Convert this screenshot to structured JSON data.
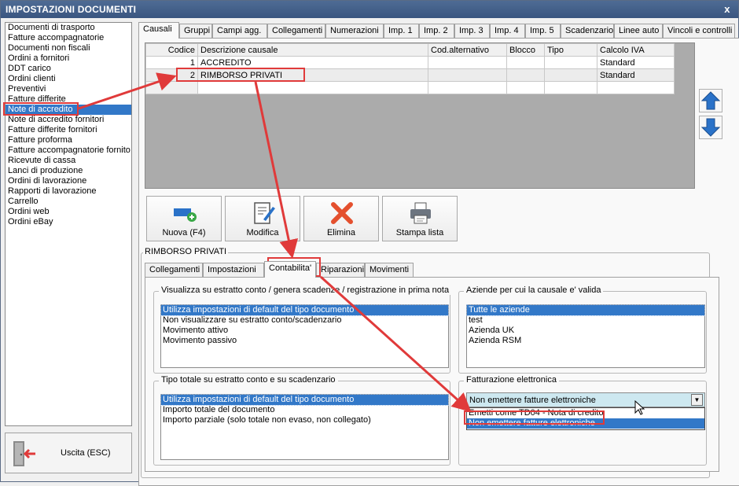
{
  "window": {
    "title": "IMPOSTAZIONI DOCUMENTI",
    "close_label": "x"
  },
  "doc_list": {
    "items": [
      "Documenti di trasporto",
      "Fatture accompagnatorie",
      "Documenti non fiscali",
      "Ordini a fornitori",
      "DDT carico",
      "Ordini clienti",
      "Preventivi",
      "Fatture differite",
      "Note di accredito",
      "Note di accredito fornitori",
      "Fatture differite fornitori",
      "Fatture proforma",
      "Fatture accompagnatorie fornito",
      "Ricevute di cassa",
      "Lanci di produzione",
      "Ordini di lavorazione",
      "Rapporti di lavorazione",
      "Carrello",
      "Ordini web",
      "Ordini eBay"
    ],
    "selected": "Note di accredito"
  },
  "exit_button": {
    "label": "Uscita (ESC)",
    "icon": "exit-door-icon"
  },
  "main_tabs": [
    "Causali",
    "Gruppi",
    "Campi agg.",
    "Collegamenti",
    "Numerazioni",
    "Imp. 1",
    "Imp. 2",
    "Imp. 3",
    "Imp. 4",
    "Imp. 5",
    "Scadenzario",
    "Linee auto",
    "Vincoli e controlli"
  ],
  "causali_table": {
    "columns": [
      "Codice",
      "Descrizione causale",
      "Cod.alternativo",
      "Blocco",
      "Tipo",
      "Calcolo IVA"
    ],
    "rows": [
      {
        "code": "1",
        "description": "ACCREDITO",
        "alt": "",
        "block": "",
        "type": "",
        "vat": "Standard"
      },
      {
        "code": "2",
        "description": "RIMBORSO PRIVATI",
        "alt": "",
        "block": "",
        "type": "",
        "vat": "Standard"
      }
    ]
  },
  "move_buttons": {
    "up_icon": "arrow-up-icon",
    "down_icon": "arrow-down-icon"
  },
  "actions": [
    {
      "label": "Nuova (F4)",
      "icon": "new-document-icon"
    },
    {
      "label": "Modifica",
      "icon": "edit-document-icon"
    },
    {
      "label": "Elimina",
      "icon": "delete-x-icon"
    },
    {
      "label": "Stampa lista",
      "icon": "printer-icon"
    }
  ],
  "detail": {
    "title": "RIMBORSO PRIVATI",
    "tabs": [
      "Collegamenti",
      "Impostazioni",
      "Contabilita'",
      "Riparazioni",
      "Movimenti"
    ],
    "active_tab": "Contabilita'",
    "statement_group": {
      "legend": "Visualizza su estratto conto / genera scadenze / registrazione  in prima nota",
      "options": [
        "Utilizza impostazioni di default del tipo documento",
        "Non visualizzare su estratto conto/scadenzario",
        "Movimento attivo",
        "Movimento passivo"
      ],
      "selected": "Utilizza impostazioni di default del tipo documento"
    },
    "companies_group": {
      "legend": "Aziende per cui la causale e' valida",
      "options": [
        "Tutte le aziende",
        "test",
        "Azienda UK",
        "Azienda RSM"
      ],
      "selected": "Tutte le aziende"
    },
    "total_group": {
      "legend": "Tipo totale su estratto conto e su scadenzario",
      "options": [
        "Utilizza impostazioni di default del tipo documento",
        "Importo totale del documento",
        "Importo parziale (solo totale non evaso, non collegato)"
      ],
      "selected": "Utilizza impostazioni di default del tipo documento"
    },
    "einvoice_group": {
      "legend": "Fatturazione elettronica",
      "value": "Non emettere fatture elettroniche",
      "options": [
        "Emetti come TD04 - Nota di credito",
        "Non emettere fatture elettroniche"
      ],
      "highlighted": "Non emettere fatture elettroniche"
    }
  },
  "colors": {
    "selection": "#3278c8",
    "annotation_red": "#e03a3a",
    "titlebar": "#3f5a84"
  }
}
